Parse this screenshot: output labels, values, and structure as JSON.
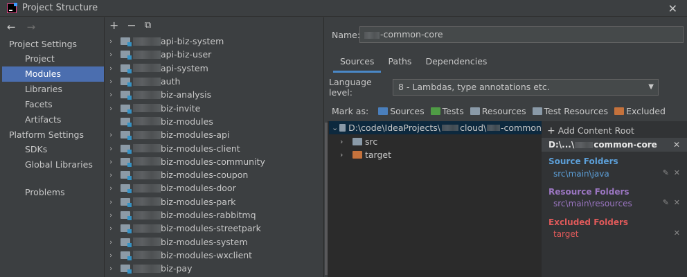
{
  "window": {
    "title": "Project Structure"
  },
  "nav": {
    "back": "←",
    "forward": "→"
  },
  "sidebar": {
    "project_settings": "Project Settings",
    "project_items": [
      "Project",
      "Modules",
      "Libraries",
      "Facets",
      "Artifacts"
    ],
    "selected": "Modules",
    "platform_settings": "Platform Settings",
    "platform_items": [
      "SDKs",
      "Global Libraries"
    ],
    "problems": "Problems"
  },
  "modules_toolbar": {
    "add": "+",
    "remove": "−",
    "copy": "⧉"
  },
  "modules": [
    "api-biz-system",
    "api-biz-user",
    "api-system",
    "auth",
    "biz-analysis",
    "biz-invite",
    "biz-modules",
    "biz-modules-api",
    "biz-modules-client",
    "biz-modules-community",
    "biz-modules-coupon",
    "biz-modules-door",
    "biz-modules-park",
    "biz-modules-rabbitmq",
    "biz-modules-streetpark",
    "biz-modules-system",
    "biz-modules-wxclient",
    "biz-pay"
  ],
  "detail": {
    "name_label": "Name:",
    "name_value": "-common-core",
    "tabs": [
      "Sources",
      "Paths",
      "Dependencies"
    ],
    "active_tab": "Sources",
    "language_label": "Language level:",
    "language_value": "8 - Lambdas, type annotations etc.",
    "mark_as_label": "Mark as:",
    "mark_as": [
      {
        "label": "Sources",
        "color": "#4a7fbc"
      },
      {
        "label": "Tests",
        "color": "#4f9c45"
      },
      {
        "label": "Resources",
        "color": "#8a9aa8"
      },
      {
        "label": "Test Resources",
        "color": "#8a9aa8"
      },
      {
        "label": "Excluded",
        "color": "#c5723c"
      }
    ],
    "tree": {
      "root_path": "D:\\code\\IdeaProjects\\",
      "root_mid": "cloud\\",
      "root_end": "-common",
      "children": [
        {
          "label": "src",
          "color": "#8a9aa8"
        },
        {
          "label": "target",
          "color": "#c5723c"
        }
      ]
    },
    "content_root": {
      "add_label": "Add Content Root",
      "root_label_start": "D:\\...\\",
      "root_label_end": "common-core",
      "source_folders_title": "Source Folders",
      "source_folder": "src\\main\\java",
      "resource_folders_title": "Resource Folders",
      "resource_folder": "src\\main\\resources",
      "excluded_folders_title": "Excluded Folders",
      "excluded_folder": "target",
      "colors": {
        "source": "#5c9fd8",
        "resource": "#9b76c2",
        "excluded": "#e05a5a"
      }
    }
  }
}
